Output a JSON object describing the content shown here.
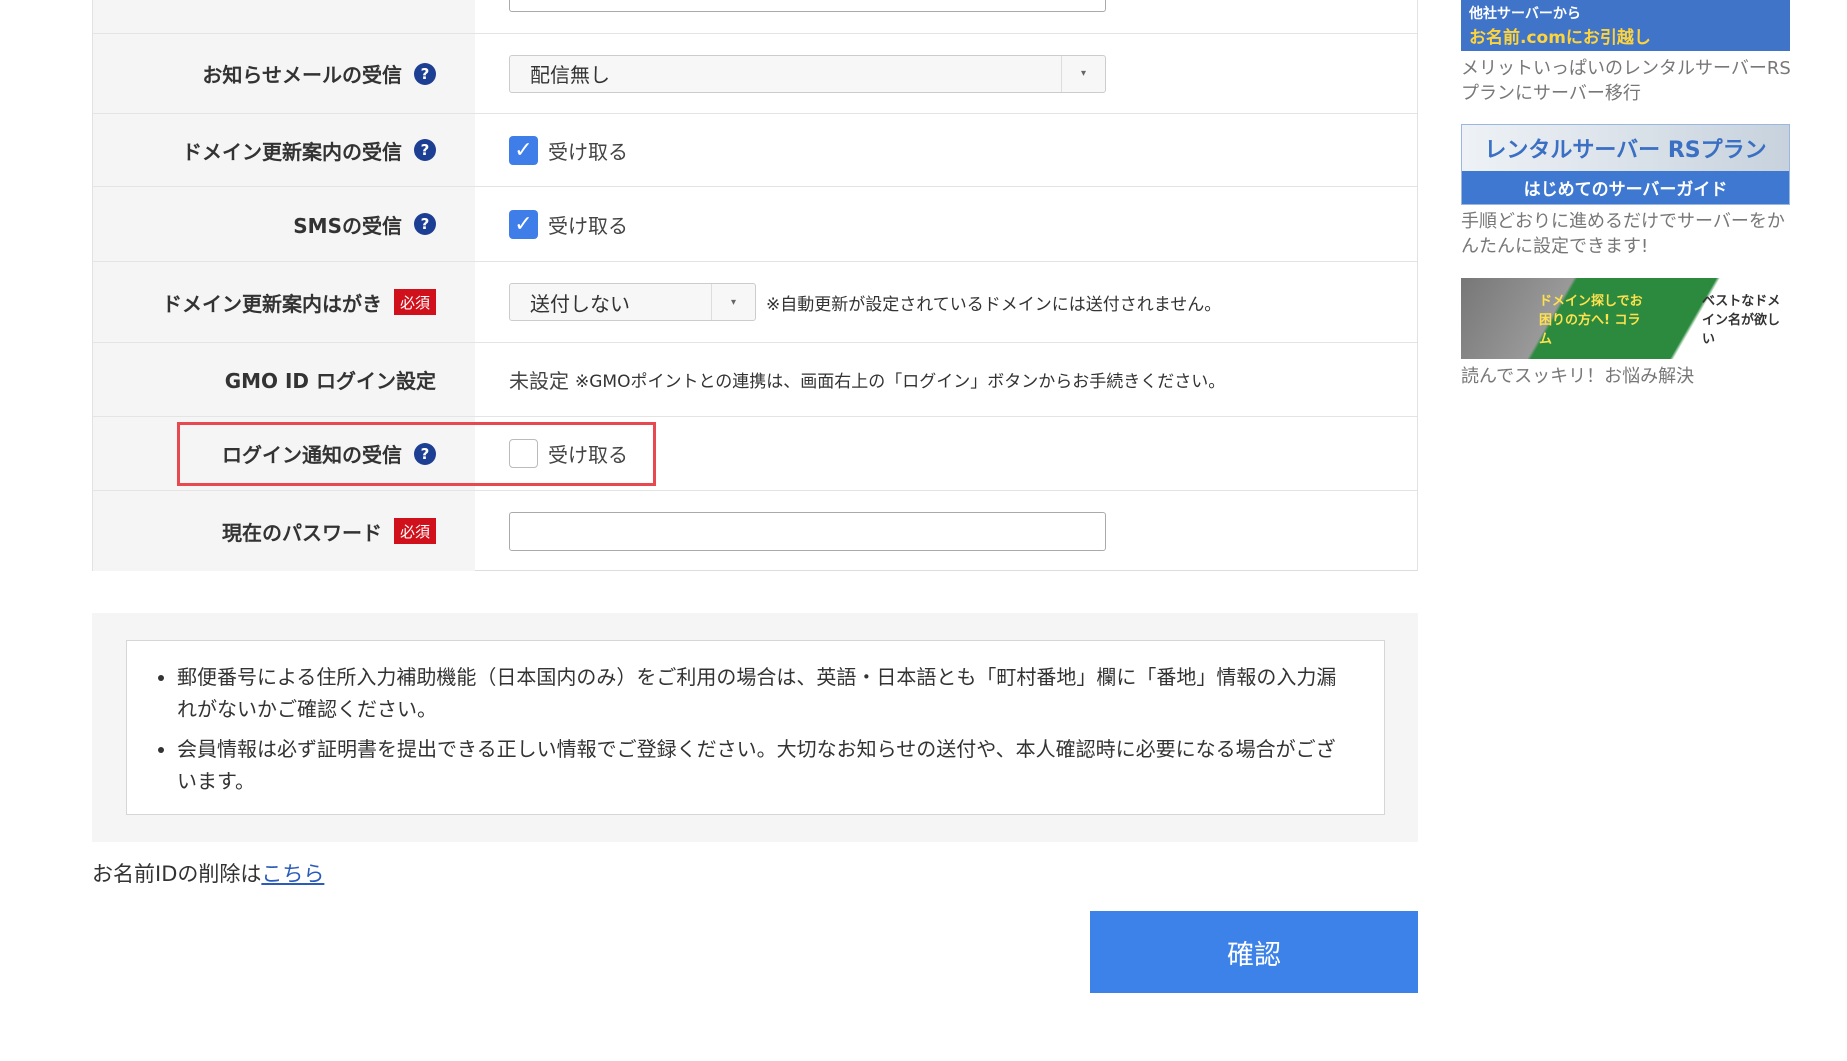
{
  "form": {
    "rows": [
      {
        "label": "お知らせメールの受信",
        "type": "select",
        "value": "配信無し"
      },
      {
        "label": "ドメイン更新案内の受信",
        "type": "checkbox",
        "checked": true,
        "checkbox_label": "受け取る"
      },
      {
        "label": "SMSの受信",
        "type": "checkbox",
        "checked": true,
        "checkbox_label": "受け取る"
      },
      {
        "label": "ドメイン更新案内はがき",
        "required": "必須",
        "type": "select",
        "value": "送付しない",
        "note": "※自動更新が設定されているドメインには送付されません。"
      },
      {
        "label": "GMO ID ログイン設定",
        "type": "text",
        "value": "未設定",
        "note": "※GMOポイントとの連携は、画面右上の「ログイン」ボタンからお手続きください。"
      },
      {
        "label": "ログイン通知の受信",
        "type": "checkbox",
        "checked": false,
        "checkbox_label": "受け取る",
        "highlighted": true
      },
      {
        "label": "現在のパスワード",
        "required": "必須",
        "type": "password",
        "value": ""
      }
    ],
    "help_icon": "?",
    "dropdown_icon": "▾"
  },
  "notes": [
    "郵便番号による住所入力補助機能（日本国内のみ）をご利用の場合は、英語・日本語とも「町村番地」欄に「番地」情報の入力漏れがないかご確認ください。",
    "会員情報は必ず証明書を提出できる正しい情報でご登録ください。大切なお知らせの送付や、本人確認時に必要になる場合がございます。"
  ],
  "delete": {
    "prefix": "お名前IDの削除は",
    "link": "こちら"
  },
  "confirm_label": "確認",
  "sidebar": [
    {
      "banner_line1": "他社サーバーから",
      "banner_line2": "お名前.comにお引越し",
      "caption": "メリットいっぱいのレンタルサーバーRSプランにサーバー移行"
    },
    {
      "banner_line1": "レンタルサーバー RSプラン",
      "banner_line2": "はじめてのサーバーガイド",
      "caption": "手順どおりに進めるだけでサーバーをかんたんに設定できます!"
    },
    {
      "banner_line1": "ドメイン探しでお困りの方へ! コラム",
      "banner_line2": "ベストなドメイン名が欲しい",
      "caption": "読んでスッキリ！お悩み解決"
    }
  ],
  "colors": {
    "accent": "#3d82e8",
    "required": "#d0101b",
    "highlight": "#e8484f",
    "help": "#1d3f93"
  }
}
